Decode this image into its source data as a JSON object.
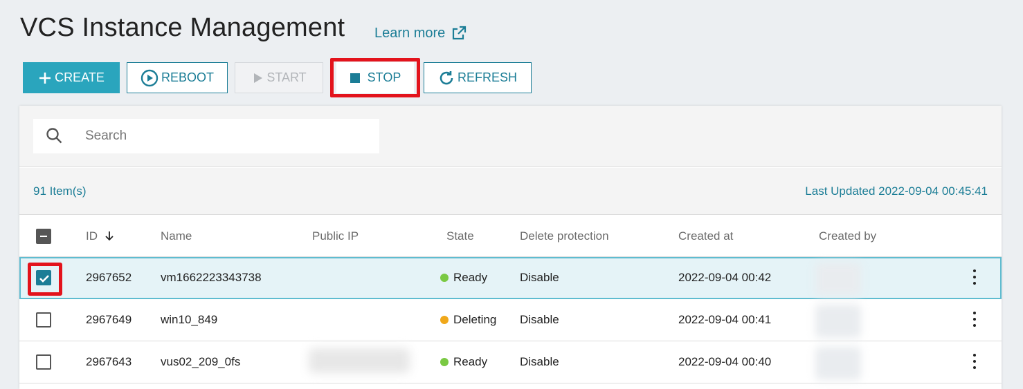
{
  "page": {
    "title": "VCS Instance Management",
    "learn_more": "Learn more"
  },
  "toolbar": {
    "create": "CREATE",
    "reboot": "REBOOT",
    "start": "START",
    "stop": "STOP",
    "refresh": "REFRESH"
  },
  "search": {
    "placeholder": "Search"
  },
  "summary": {
    "count": "91 Item(s)",
    "last_updated": "Last Updated 2022-09-04 00:45:41"
  },
  "table": {
    "headers": {
      "id": "ID",
      "name": "Name",
      "public_ip": "Public IP",
      "state": "State",
      "delete_protection": "Delete protection",
      "created_at": "Created at",
      "created_by": "Created by"
    },
    "rows": [
      {
        "id": "2967652",
        "name": "vm1662223343738",
        "state": "Ready",
        "state_color": "#7ac943",
        "delete_protection": "Disable",
        "created_at": "2022-09-04 00:42",
        "selected": true
      },
      {
        "id": "2967649",
        "name": "win10_849",
        "state": "Deleting",
        "state_color": "#f0a81a",
        "delete_protection": "Disable",
        "created_at": "2022-09-04 00:41",
        "selected": false
      },
      {
        "id": "2967643",
        "name": "vus02_209_0fs",
        "state": "Ready",
        "state_color": "#7ac943",
        "delete_protection": "Disable",
        "created_at": "2022-09-04 00:40",
        "selected": false
      }
    ]
  },
  "colors": {
    "accent": "#1b7d96",
    "primary_button": "#2aa5bd",
    "highlight_red": "#e3131c"
  }
}
